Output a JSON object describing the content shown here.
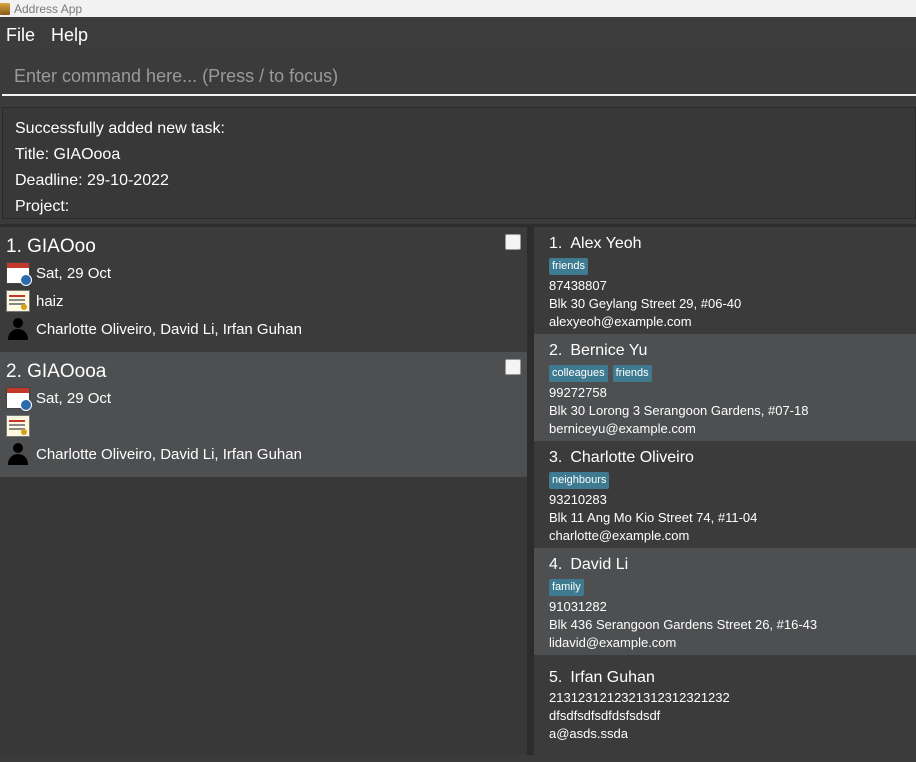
{
  "window": {
    "title": "Address App"
  },
  "menu": {
    "file": "File",
    "help": "Help"
  },
  "command": {
    "placeholder": "Enter command here... (Press / to focus)"
  },
  "result": {
    "lines": [
      "Successfully added new task:",
      "Title: GIAOooa",
      "Deadline: 29-10-2022",
      "Project:"
    ]
  },
  "tasks": [
    {
      "title": "1. GIAOoo",
      "deadline": "Sat, 29 Oct",
      "description": "haiz",
      "members": "Charlotte Oliveiro, David Li, Irfan Guhan",
      "done": false
    },
    {
      "title": "2. GIAOooa",
      "deadline": "Sat, 29 Oct",
      "description": "",
      "members": "Charlotte Oliveiro, David Li, Irfan Guhan",
      "done": false
    }
  ],
  "persons": [
    {
      "index": "1.",
      "name": "Alex Yeoh",
      "tags": [
        "friends"
      ],
      "phone": "87438807",
      "address": "Blk 30 Geylang Street 29, #06-40",
      "email": "alexyeoh@example.com"
    },
    {
      "index": "2.",
      "name": "Bernice Yu",
      "tags": [
        "colleagues",
        "friends"
      ],
      "phone": "99272758",
      "address": "Blk 30 Lorong 3 Serangoon Gardens, #07-18",
      "email": "berniceyu@example.com"
    },
    {
      "index": "3.",
      "name": "Charlotte Oliveiro",
      "tags": [
        "neighbours"
      ],
      "phone": "93210283",
      "address": "Blk 11 Ang Mo Kio Street 74, #11-04",
      "email": "charlotte@example.com"
    },
    {
      "index": "4.",
      "name": "David Li",
      "tags": [
        "family"
      ],
      "phone": "91031282",
      "address": "Blk 436 Serangoon Gardens Street 26, #16-43",
      "email": "lidavid@example.com"
    },
    {
      "index": "5.",
      "name": "Irfan Guhan",
      "tags": [],
      "phone": "2131231212321312312321232",
      "address": "dfsdfsdfsdfdsfsdsdf",
      "email": "a@asds.ssda"
    }
  ],
  "colors": {
    "background": "#3b3b3b",
    "card_alt": "#4d4f51",
    "tag": "#3e7b91"
  }
}
